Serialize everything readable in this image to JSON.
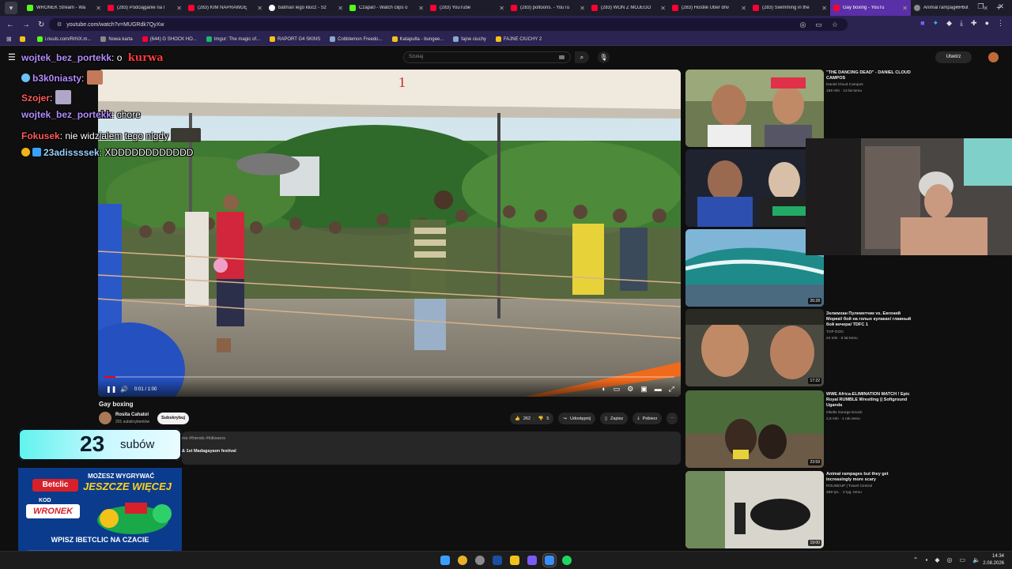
{
  "browser": {
    "tabs": [
      {
        "label": "WRONEK Stream - Wa",
        "icon": "kick-icon"
      },
      {
        "label": "(283) Podciąganie na l",
        "icon": "youtube-icon"
      },
      {
        "label": "(283) KIM NAPRAWDĘ",
        "icon": "youtube-icon"
      },
      {
        "label": "batman lego klucz - Sz",
        "icon": "google-icon"
      },
      {
        "label": "Czapa0 - Watch clips o",
        "icon": "kick-icon"
      },
      {
        "label": "(283) YouTube",
        "icon": "youtube-icon"
      },
      {
        "label": "(283) poltoons. - YouTu",
        "icon": "youtube-icon"
      },
      {
        "label": "(283) WON Z MOJEGO",
        "icon": "youtube-icon"
      },
      {
        "label": "(283) Hostile Uber driv",
        "icon": "youtube-icon"
      },
      {
        "label": "(283) Swimming in the",
        "icon": "youtube-icon"
      },
      {
        "label": "Gay boxing - YouTu",
        "icon": "youtube-icon",
        "active": true
      },
      {
        "label": "Animal rampages but",
        "icon": "generic-icon"
      }
    ],
    "url": "youtube.com/watch?v=MUGRdk7QyXw",
    "bookmarks": [
      {
        "label": "",
        "icon": "folder-icon"
      },
      {
        "label": "i.nuuls.com/RrhlX.m...",
        "icon": "link-icon"
      },
      {
        "label": "Nowa karta",
        "icon": "page-icon"
      },
      {
        "label": "(644) G SHOCK HO...",
        "icon": "youtube-icon"
      },
      {
        "label": "Imgur: The magic of...",
        "icon": "imgur-icon"
      },
      {
        "label": "RAPORT G4 SKINS",
        "icon": "folder-icon"
      },
      {
        "label": "Cobblemon Freedo...",
        "icon": "globe-icon"
      },
      {
        "label": "Katapulta - bungee...",
        "icon": "folder-icon"
      },
      {
        "label": "fajne ciuchy",
        "icon": "globe-icon"
      },
      {
        "label": "FAJNE CIUCHY 2",
        "icon": "folder-icon"
      }
    ]
  },
  "youtube": {
    "search_placeholder": "Szukaj",
    "create_label": "Utwórz",
    "video": {
      "title": "Gay boxing",
      "time": "0:01 / 1:00",
      "progress": 0.02,
      "channel": "Rosita Cahatol",
      "subscribers": "201 subskrybentów",
      "subscribe_label": "Subskrybuj",
      "likes": "262",
      "dislikes": "5",
      "share_label": "Udostępnij",
      "save_label": "Zapisz",
      "download_label": "Pobierz",
      "description_line1": "me #friends #followers",
      "description_line2": "& 1st Madagayaon festival"
    },
    "recommendations": [
      {
        "title": "\"THE DANCING DEAD\" - DANIEL CLOUD CAMPOS",
        "channel": "Daniel Cloud Campos",
        "meta": "159 mln · 13 lat temu",
        "duration": ""
      },
      {
        "title": "",
        "channel": "",
        "meta": "",
        "duration": ""
      },
      {
        "title": "",
        "channel": "",
        "meta": "",
        "duration": "26:28"
      },
      {
        "title": "Зелимхан Пулеметчик vs. Евгений Морякі/ бой на голых кулаках/ главный бой вечера/ TDFC 1",
        "channel": "TOP DOG",
        "meta": "24 mln · 6 lat temu",
        "duration": "17:22"
      },
      {
        "title": "WWE Africa-ELIMINATION MATCH ! Epic Royal RUMBLE Wrestling || Softground Uganda",
        "channel": "Okello George Enock",
        "meta": "2,6 mln · 1 rok temu",
        "duration": "23:59"
      },
      {
        "title": "Animal rampages but they get increasingly more scary",
        "channel": "ROUNDUP | Travel Central",
        "meta": "459 tys. · 2 tyg. temu",
        "duration": "19:00"
      }
    ]
  },
  "stream_overlay": {
    "chat": [
      {
        "user": "wojtek_bez_portekk",
        "message": "o",
        "user_color": "#b48cff",
        "emote": "kurwa"
      },
      {
        "user": "b3k0niasty",
        "message": "",
        "user_color": "#b48cff",
        "emote": "face"
      },
      {
        "user": "Szojer",
        "message": "",
        "user_color": "#ff5a5a",
        "emote": "face"
      },
      {
        "user": "wojtek_bez_portekk",
        "message": "chore",
        "user_color": "#b48cff",
        "emote": ""
      },
      {
        "user": "Fokusek",
        "message": "nie widzialem tego nigdy",
        "user_color": "#ff5a5a",
        "emote": "cat"
      },
      {
        "user": "23adissssek",
        "message": "XDDDDDDDDDDDD",
        "user_color": "#9ad0ff",
        "emote": ""
      }
    ],
    "emote_text": "kurwa",
    "sub_count": "23",
    "sub_label": "subów",
    "ad": {
      "brand": "Betclic",
      "headline1": "MOŻESZ WYGRYWAĆ",
      "headline2": "JESZCZE WIĘCEJ",
      "kod_label": "KOD",
      "code": "WRONEK",
      "cta": "WPISZ IBETCLIC NA CZACIE"
    }
  },
  "taskbar": {
    "time": "14:34",
    "date": "2.08.2026"
  }
}
